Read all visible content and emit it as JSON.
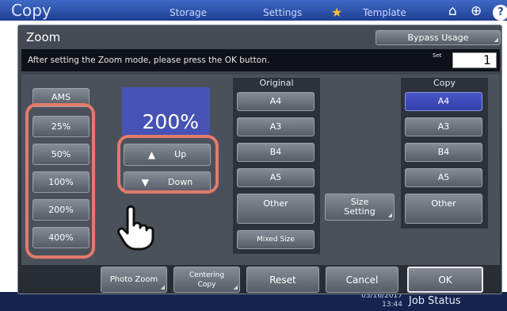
{
  "background": {
    "title": "Copy",
    "tabs": [
      "Storage",
      "Settings",
      "Template"
    ],
    "date": "03/16/2017",
    "time": "13:44",
    "job_status": "Job Status"
  },
  "dialog": {
    "title": "Zoom",
    "bypass_usage": "Bypass Usage",
    "message": "After setting the Zoom mode, please press the OK button.",
    "set_label": "Set",
    "set_value": "1"
  },
  "zoom": {
    "ams": "AMS",
    "presets": [
      "25%",
      "50%",
      "100%",
      "200%",
      "400%"
    ],
    "display_value": "200%",
    "up_label": "Up",
    "down_label": "Down"
  },
  "original": {
    "header": "Original",
    "sizes": [
      "A4",
      "A3",
      "B4",
      "A5"
    ],
    "other": "Other",
    "mixed_size": "Mixed Size"
  },
  "size_setting": "Size Setting",
  "copy": {
    "header": "Copy",
    "selected": "A4",
    "sizes": [
      "A4",
      "A3",
      "B4",
      "A5"
    ],
    "other": "Other"
  },
  "actions": {
    "photo_zoom": "Photo Zoom",
    "centering_copy": "Centering Copy",
    "reset": "Reset",
    "cancel": "Cancel",
    "ok": "OK"
  },
  "colors": {
    "accent_selected": "#3a46b8",
    "callout": "#e37a6b",
    "top_bar": "#2d4fa8"
  },
  "icons": [
    "star-icon",
    "home-icon",
    "globe-icon",
    "help-icon",
    "up-triangle-icon",
    "down-triangle-icon",
    "hand-pointer-icon"
  ]
}
